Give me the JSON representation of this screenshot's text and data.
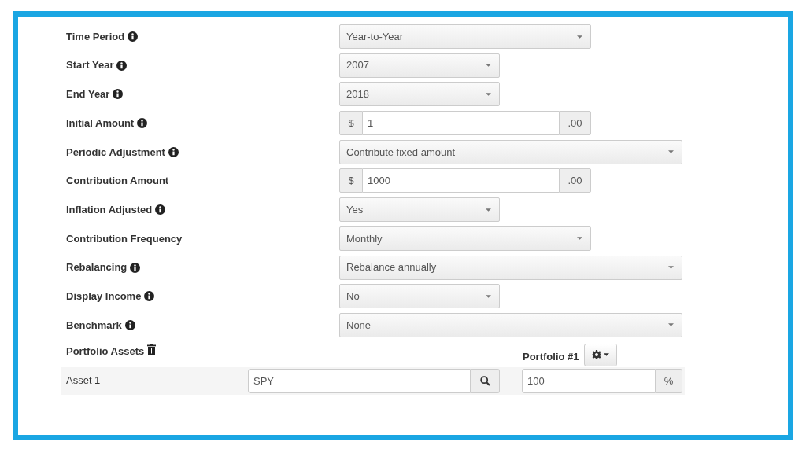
{
  "form": {
    "fields": [
      {
        "label": "Time Period",
        "info": true,
        "kind": "select",
        "value": "Year-to-Year"
      },
      {
        "label": "Start Year",
        "info": true,
        "kind": "short-select",
        "value": "2007"
      },
      {
        "label": "End Year",
        "info": true,
        "kind": "short-select",
        "value": "2018"
      },
      {
        "label": "Initial Amount",
        "info": true,
        "kind": "amount",
        "prefix": "$",
        "value": "1",
        "suffix": ".00"
      },
      {
        "label": "Periodic Adjustment",
        "info": true,
        "kind": "wide-select",
        "value": "Contribute fixed amount"
      },
      {
        "label": "Contribution Amount",
        "info": false,
        "kind": "amount",
        "prefix": "$",
        "value": "1000",
        "suffix": ".00"
      },
      {
        "label": "Inflation Adjusted",
        "info": true,
        "kind": "short-select",
        "value": "Yes"
      },
      {
        "label": "Contribution Frequency",
        "info": false,
        "kind": "select",
        "value": "Monthly"
      },
      {
        "label": "Rebalancing",
        "info": true,
        "kind": "wide-select",
        "value": "Rebalance annually"
      },
      {
        "label": "Display Income",
        "info": true,
        "kind": "short-select",
        "value": "No"
      },
      {
        "label": "Benchmark",
        "info": true,
        "kind": "wide-select",
        "value": "None"
      }
    ]
  },
  "portfolio": {
    "label": "Portfolio Assets",
    "name": "Portfolio #1",
    "assets": [
      {
        "label": "Asset 1",
        "ticker": "SPY",
        "allocation": "100",
        "unit": "%"
      }
    ]
  }
}
